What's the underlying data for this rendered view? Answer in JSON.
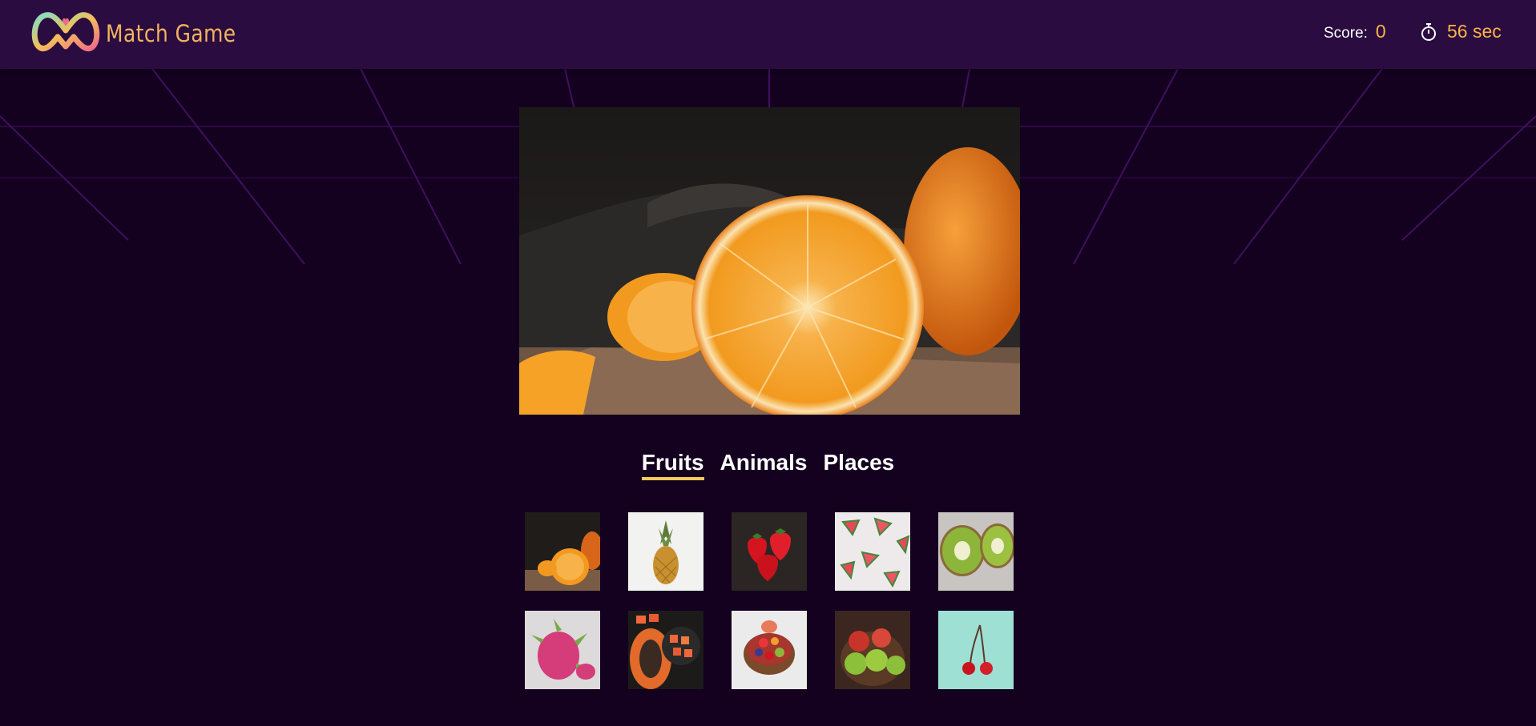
{
  "header": {
    "brand": "Match Game",
    "logo_icon": "game-controller-logo-icon",
    "score_label": "Score:",
    "score_value": "0",
    "timer_icon": "stopwatch-icon",
    "timer_value": "56 sec"
  },
  "main_image": {
    "subject": "orange"
  },
  "tabs": [
    {
      "label": "Fruits",
      "active": true
    },
    {
      "label": "Animals",
      "active": false
    },
    {
      "label": "Places",
      "active": false
    }
  ],
  "thumbnails": [
    {
      "subject": "orange"
    },
    {
      "subject": "pineapple"
    },
    {
      "subject": "strawberry"
    },
    {
      "subject": "watermelon"
    },
    {
      "subject": "kiwi"
    },
    {
      "subject": "dragon-fruit"
    },
    {
      "subject": "papaya"
    },
    {
      "subject": "fruit-bowl"
    },
    {
      "subject": "apple"
    },
    {
      "subject": "cherry"
    }
  ],
  "colors": {
    "background": "#14001f",
    "navbar": "#2a0c40",
    "accent": "#ffb347",
    "active_tab_underline": "#f6c95b"
  }
}
